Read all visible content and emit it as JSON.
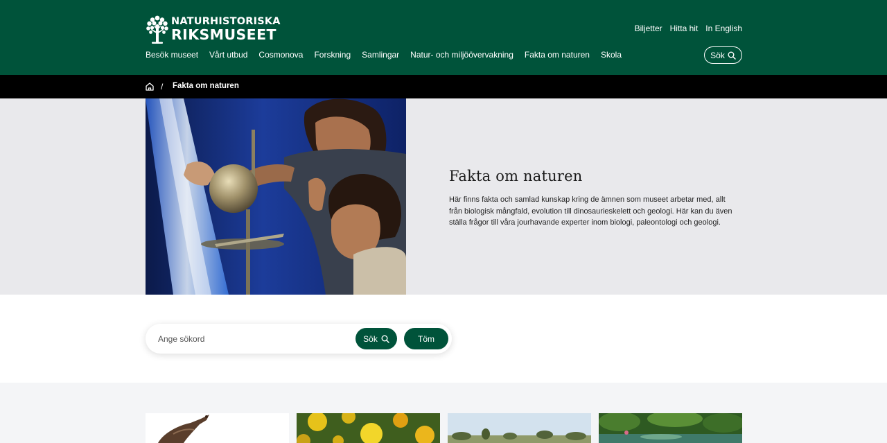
{
  "header": {
    "logo": {
      "line1": "NATURHISTORISKA",
      "line2": "RIKSMUSEET",
      "icon": "tree-logo-icon"
    },
    "top_links": [
      "Biljetter",
      "Hitta hit",
      "In English"
    ],
    "nav_items": [
      "Besök museet",
      "Vårt utbud",
      "Cosmonova",
      "Forskning",
      "Samlingar",
      "Natur- och miljöövervakning",
      "Fakta om naturen",
      "Skola"
    ],
    "search_label": "Sök"
  },
  "breadcrumb": {
    "home_icon": "home-icon",
    "separator": "/",
    "current": "Fakta om naturen"
  },
  "hero": {
    "title": "Fakta om naturen",
    "text": "Här finns fakta och samlad kunskap kring de ämnen som museet arbetar med, allt från biologisk mångfald, evolution till dinosaurieskelett och geologi. Här kan du även ställa frågor till våra jourhavande experter inom biologi, paleontologi och geologi.",
    "image": "children-exploring-metal-sphere-photo"
  },
  "search": {
    "placeholder": "Ange sökord",
    "value": "",
    "submit_label": "Sök",
    "clear_label": "Töm"
  },
  "cards": [
    {
      "image": "bird-photo"
    },
    {
      "image": "yellow-flowers-photo"
    },
    {
      "image": "landscape-trees-photo"
    },
    {
      "image": "green-garden-pond-photo"
    }
  ],
  "colors": {
    "brand_green": "#00533a",
    "breadcrumb_bg": "#000000",
    "hero_bg": "#e9e9ec",
    "cards_bg": "#f4f5f7"
  }
}
